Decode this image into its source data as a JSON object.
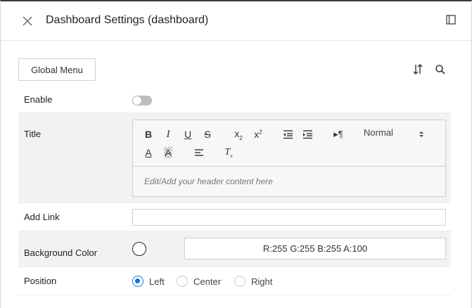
{
  "panel": {
    "title": "Dashboard Settings (dashboard)"
  },
  "toolbar_top": {
    "global_menu_label": "Global Menu"
  },
  "settings": {
    "enable": {
      "label": "Enable",
      "value": false
    },
    "title": {
      "label": "Title",
      "editor": {
        "format_select": "Normal",
        "placeholder": "Edit/Add your header content here"
      }
    },
    "add_link": {
      "label": "Add Link",
      "value": ""
    },
    "background_color": {
      "label": "Background Color",
      "value": "R:255 G:255 B:255 A:100",
      "swatch_color": "#ffffff"
    },
    "position": {
      "label": "Position",
      "options": [
        {
          "label": "Left",
          "selected": true
        },
        {
          "label": "Center",
          "selected": false
        },
        {
          "label": "Right",
          "selected": false
        }
      ]
    }
  },
  "colors": {
    "accent": "#1a73e8",
    "row_shade": "#f2f2f2",
    "toggle_off": "#bdbdbd"
  }
}
